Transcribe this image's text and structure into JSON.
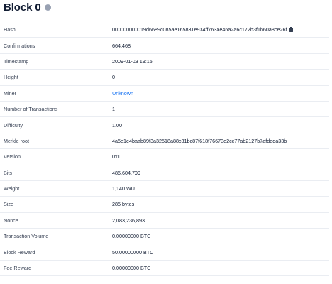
{
  "page": {
    "title": "Block 0"
  },
  "rows": [
    {
      "label": "Hash",
      "value": "000000000019d6689c085ae165831e934ff763ae46a2a6c172b3f1b60a8ce26f"
    },
    {
      "label": "Confirmations",
      "value": "664,468"
    },
    {
      "label": "Timestamp",
      "value": "2009-01-03 19:15"
    },
    {
      "label": "Height",
      "value": "0"
    },
    {
      "label": "Miner",
      "value": "Unknown"
    },
    {
      "label": "Number of Transactions",
      "value": "1"
    },
    {
      "label": "Difficulty",
      "value": "1.00"
    },
    {
      "label": "Merkle root",
      "value": "4a5e1e4baab89f3a32518a88c31bc87f618f76673e2cc77ab2127b7afdeda33b"
    },
    {
      "label": "Version",
      "value": "0x1"
    },
    {
      "label": "Bits",
      "value": "486,604,799"
    },
    {
      "label": "Weight",
      "value": "1,140 WU"
    },
    {
      "label": "Size",
      "value": "285 bytes"
    },
    {
      "label": "Nonce",
      "value": "2,083,236,893"
    },
    {
      "label": "Transaction Volume",
      "value": "0.00000000 BTC"
    },
    {
      "label": "Block Reward",
      "value": "50.00000000 BTC"
    },
    {
      "label": "Fee Reward",
      "value": "0.00000000 BTC"
    }
  ],
  "icons": {
    "info": "info-circle-icon",
    "copy": "clipboard-icon"
  },
  "colors": {
    "link": "#0c6cf2",
    "divider": "#eaedf2",
    "label": "#353f52",
    "text": "#121d33"
  }
}
